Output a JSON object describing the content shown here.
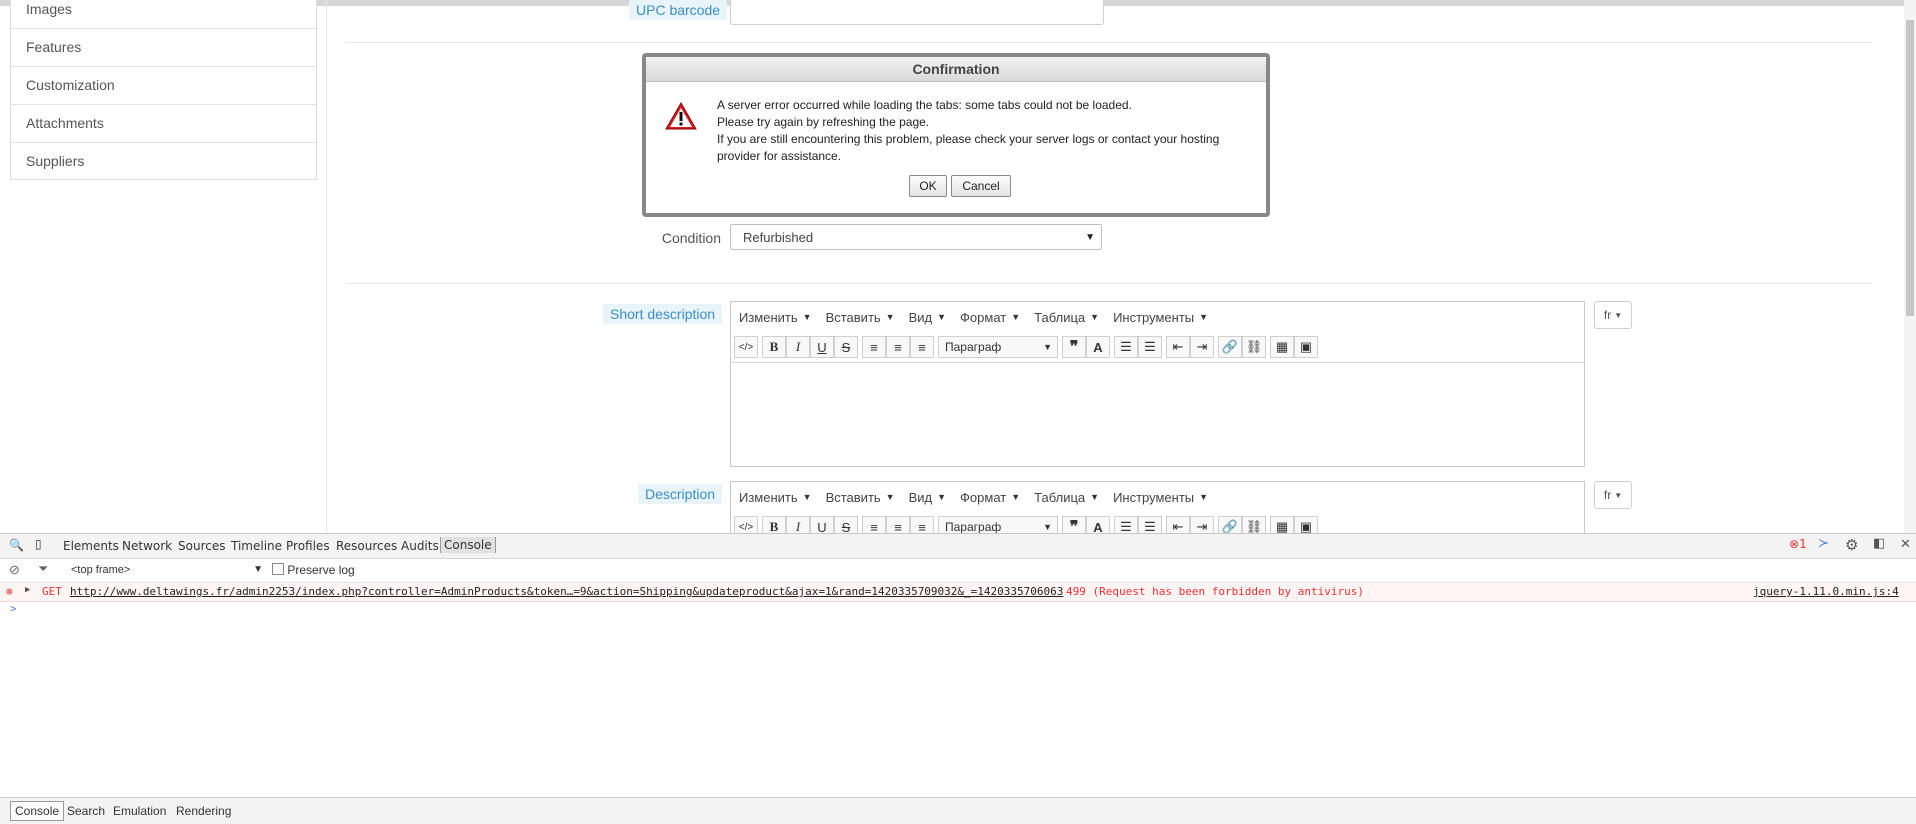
{
  "sidebar": {
    "items": [
      "Images",
      "Features",
      "Customization",
      "Attachments",
      "Suppliers"
    ]
  },
  "form": {
    "upc_label": "UPC barcode",
    "upc_value": "",
    "condition_label": "Condition",
    "condition_value": "Refurbished",
    "short_description_label": "Short description",
    "description_label": "Description",
    "language": "fr"
  },
  "editor": {
    "menus": [
      "Изменить",
      "Вставить",
      "Вид",
      "Формат",
      "Таблица",
      "Инструменты"
    ],
    "format_select": "Параграф"
  },
  "dialog": {
    "title": "Confirmation",
    "lines": [
      "A server error occurred while loading the tabs: some tabs could not be loaded.",
      "Please try again by refreshing the page.",
      "If you are still encountering this problem, please check your server logs or contact your hosting",
      "provider for assistance."
    ],
    "ok_label": "OK",
    "cancel_label": "Cancel"
  },
  "devtools": {
    "tabs": [
      "Elements",
      "Network",
      "Sources",
      "Timeline",
      "Profiles",
      "Resources",
      "Audits",
      "Console"
    ],
    "active_tab": "Console",
    "error_count": "1",
    "frame_select": "<top frame>",
    "preserve_log_label": "Preserve log",
    "error_method": "GET",
    "error_url": "http://www.deltawings.fr/admin2253/index.php?controller=AdminProducts&token…=9&action=Shipping&updateproduct&ajax=1&rand=1420335709032&_=1420335706063",
    "error_status": "499 (Request has been forbidden by antivirus)",
    "error_source": "jquery-1.11.0.min.js:4",
    "prompt": ">",
    "drawer_tabs": [
      "Console",
      "Search",
      "Emulation",
      "Rendering"
    ]
  },
  "colors": {
    "accent": "#3a8fc7",
    "error": "#e33333"
  }
}
